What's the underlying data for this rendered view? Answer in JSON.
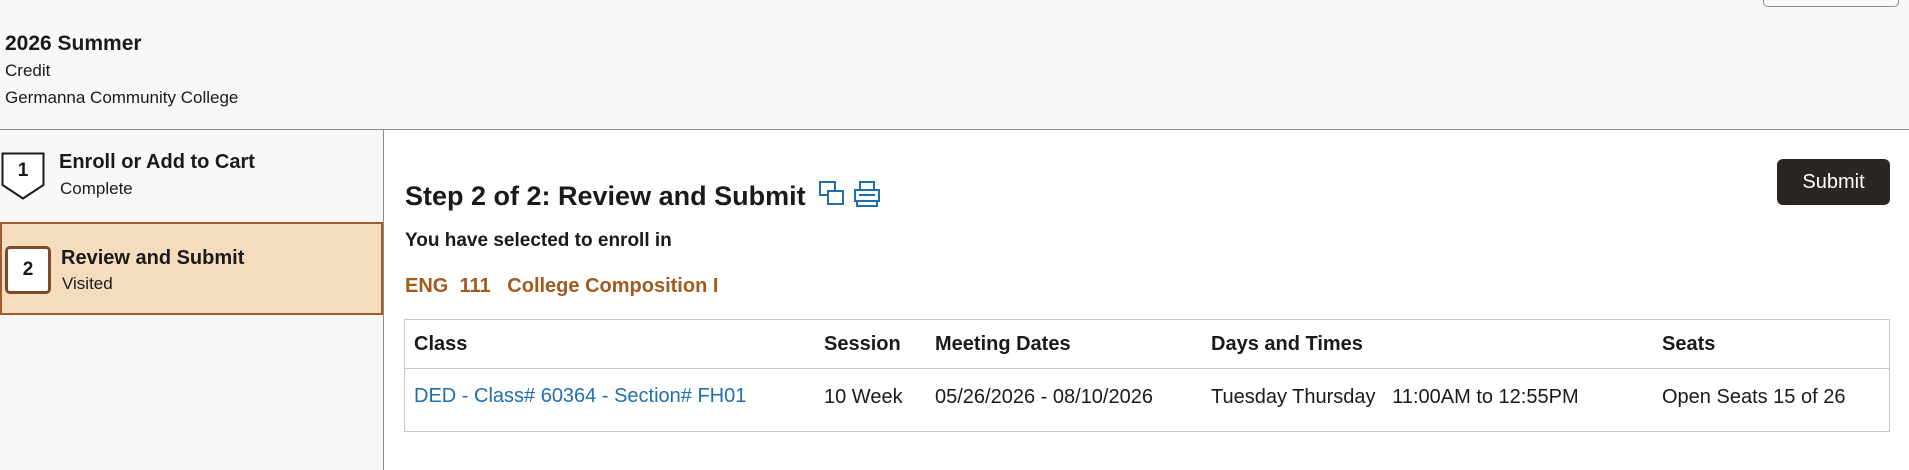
{
  "header": {
    "term": "2026 Summer",
    "career": "Credit",
    "institution": "Germanna Community College"
  },
  "steps": [
    {
      "number": "1",
      "title": "Enroll or Add to Cart",
      "status": "Complete"
    },
    {
      "number": "2",
      "title": "Review and Submit",
      "status": "Visited"
    }
  ],
  "main": {
    "title": "Step 2 of 2: Review and Submit",
    "submit_label": "Submit",
    "subtitle": "You have selected to enroll in",
    "course": "ENG  111   College Composition I",
    "icons": [
      "new-window-icon",
      "print-icon"
    ]
  },
  "table": {
    "headers": [
      "Class",
      "Session",
      "Meeting Dates",
      "Days and Times",
      "Seats"
    ],
    "row": {
      "class": "DED - Class# 60364 - Section# FH01",
      "session": "10 Week",
      "meeting_dates": "05/26/2026 - 08/10/2026",
      "days_times": "Tuesday Thursday   11:00AM to 12:55PM",
      "seats": "Open Seats 15 of 26"
    }
  },
  "colors": {
    "accent_brown": "#a25b1c",
    "active_step_bg": "#f5dcbd",
    "link_blue": "#1f6fb0",
    "submit_bg": "#2b2623"
  }
}
